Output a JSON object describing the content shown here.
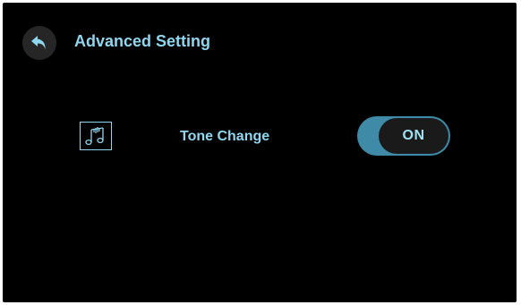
{
  "header": {
    "back_icon": "back-arrow-icon",
    "title": "Advanced Setting"
  },
  "settings": [
    {
      "icon": "music-notes-icon",
      "label": "Tone Change",
      "toggle_state": "ON"
    }
  ],
  "colors": {
    "background": "#000000",
    "accent_text": "#8fd6ee",
    "toggle_track": "#3f8aa6",
    "toggle_knob": "#1a1a1a",
    "back_button_bg": "#262626"
  }
}
